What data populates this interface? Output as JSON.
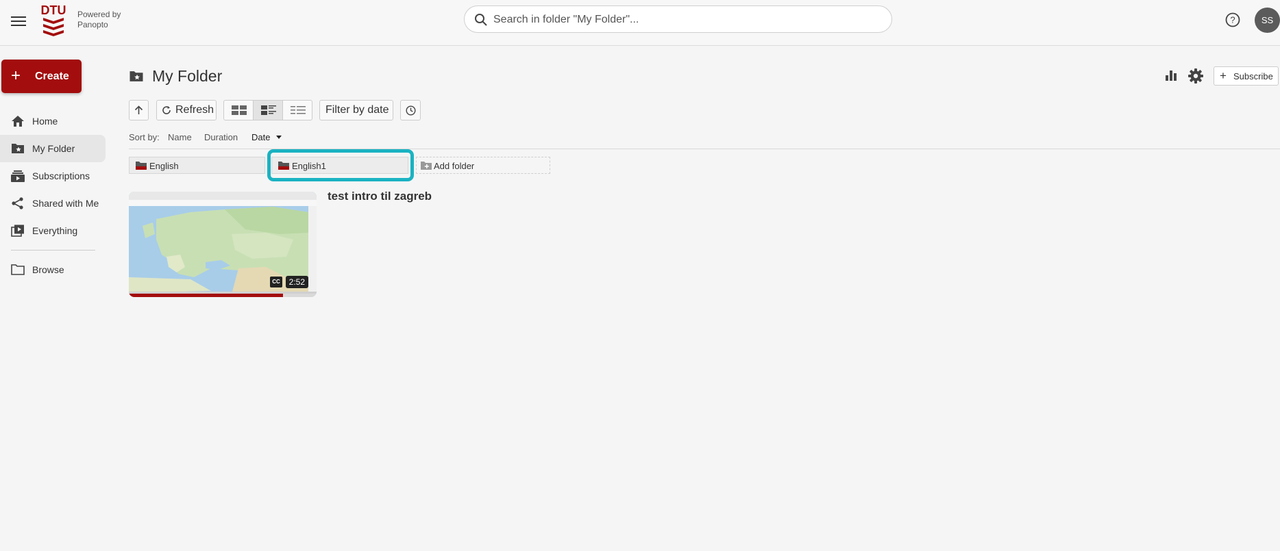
{
  "header": {
    "brand_logo_text": "DTU",
    "powered_by_line1": "Powered by",
    "powered_by_line2": "Panopto",
    "search_placeholder": "Search in folder \"My Folder\"...",
    "avatar_initials": "SS"
  },
  "sidebar": {
    "create_label": "Create",
    "items": [
      {
        "label": "Home",
        "icon": "home-icon"
      },
      {
        "label": "My Folder",
        "icon": "folder-star-icon",
        "active": true
      },
      {
        "label": "Subscriptions",
        "icon": "subscriptions-icon"
      },
      {
        "label": "Shared with Me",
        "icon": "share-icon"
      },
      {
        "label": "Everything",
        "icon": "everything-icon"
      },
      {
        "label": "Browse",
        "icon": "folder-icon"
      }
    ]
  },
  "main": {
    "title": "My Folder",
    "subscribe_label": "Subscribe",
    "toolbar": {
      "refresh_label": "Refresh",
      "filter_label": "Filter by date"
    },
    "sort": {
      "label": "Sort by:",
      "options": [
        "Name",
        "Duration",
        "Date"
      ],
      "active": "Date"
    },
    "folders": [
      "English",
      "English1"
    ],
    "add_folder_label": "Add folder",
    "sessions": [
      {
        "title": "test intro til zagreb",
        "duration": "2:52",
        "cc": "CC",
        "progress_fraction": 0.82
      }
    ]
  },
  "colors": {
    "brand_red": "#a30d0d",
    "highlight": "#1ab3c2"
  }
}
